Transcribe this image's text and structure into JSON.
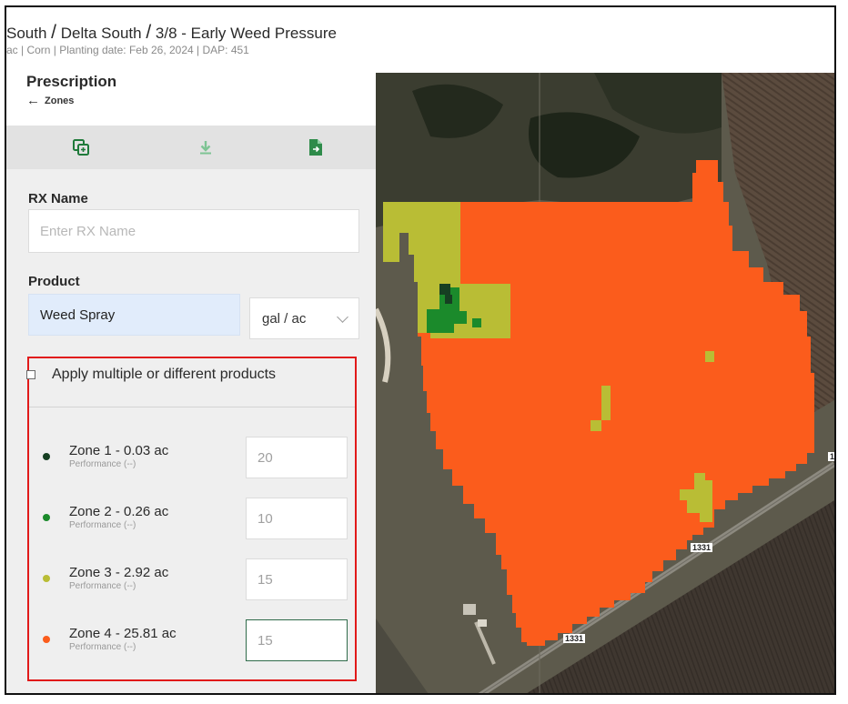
{
  "header": {
    "crumb_1": "South",
    "crumb_2": "Delta South",
    "crumb_3": "3/8 - Early Weed Pressure",
    "separator": "/",
    "subtitle": "ac | Corn | Planting date: Feb 26, 2024 | DAP: 451"
  },
  "panel": {
    "title": "Prescription",
    "back_label": "Zones",
    "tools": [
      "copy-icon",
      "download-icon",
      "export-file-icon"
    ],
    "rx_name_label": "RX Name",
    "rx_name_placeholder": "Enter RX Name",
    "product_label": "Product",
    "product_value": "Weed Spray",
    "unit_value": "gal / ac",
    "multi_products_label": "Apply multiple or different products"
  },
  "zones": [
    {
      "name": "Zone 1 - 0.03 ac",
      "performance": "Performance (--)",
      "rate": "20",
      "color": "#163f22"
    },
    {
      "name": "Zone 2 - 0.26 ac",
      "performance": "Performance (--)",
      "rate": "10",
      "color": "#1b8a2b"
    },
    {
      "name": "Zone 3 - 2.92 ac",
      "performance": "Performance (--)",
      "rate": "15",
      "color": "#b9bd35"
    },
    {
      "name": "Zone 4 - 25.81 ac",
      "performance": "Performance (--)",
      "rate": "15",
      "color": "#fb5c1c"
    }
  ],
  "map": {
    "road_labels": [
      "1331",
      "1331",
      "1"
    ]
  },
  "colors": {
    "highlight_border": "#e11a1a",
    "zone_1": "#163f22",
    "zone_2": "#1b8a2b",
    "zone_3": "#b9bd35",
    "zone_4": "#fb5c1c",
    "input_filled_bg": "#e1ecfb"
  }
}
